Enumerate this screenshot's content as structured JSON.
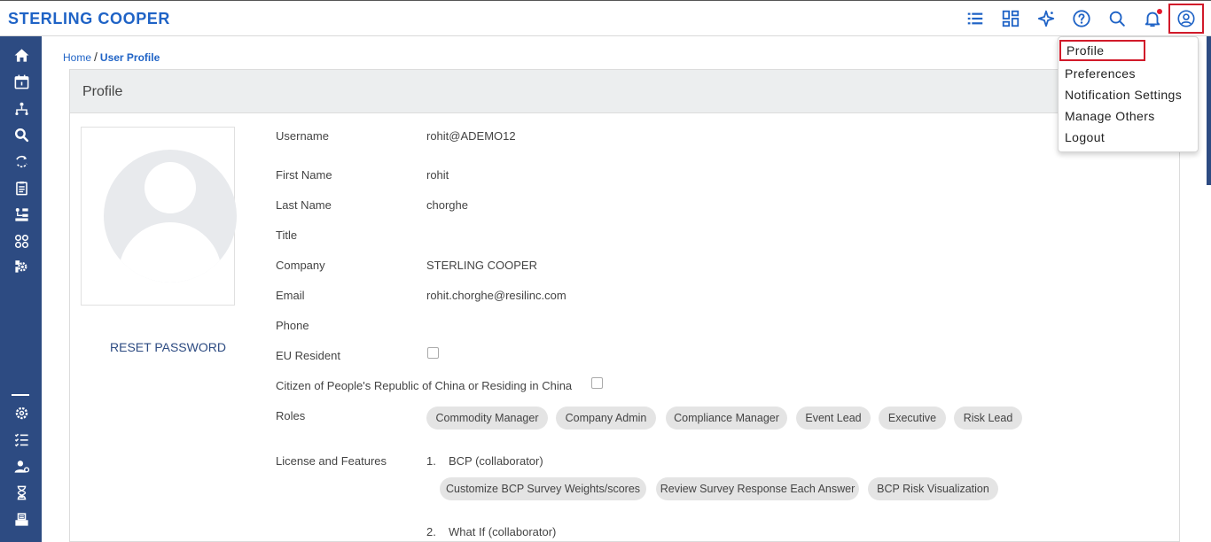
{
  "brand": "STERLING COOPER",
  "topbar": {
    "icons": [
      "list-icon",
      "dashboard-icon",
      "sparkle-icon",
      "help-icon",
      "search-icon",
      "bell-icon",
      "user-icon"
    ],
    "colors": {
      "icon": "#1f63c6",
      "notification_dot": "#e3192d",
      "highlight": "#d11a2a"
    }
  },
  "sidebar": {
    "background": "#2d4b82",
    "top_icons": [
      "home-icon",
      "calendar-icon",
      "network-icon",
      "search-doc-icon",
      "sync-icon",
      "clipboard-icon",
      "org-chart-icon",
      "apps-icon",
      "gear-stack-icon"
    ],
    "bottom_icons": [
      "settings-icon",
      "checklist-icon",
      "user-settings-icon",
      "hourglass-icon",
      "archive-icon"
    ]
  },
  "breadcrumb": {
    "home": "Home",
    "separator": "/",
    "current": "User Profile"
  },
  "card": {
    "title": "Profile"
  },
  "reset_password": "RESET PASSWORD",
  "fields": {
    "username_label": "Username",
    "username": "rohit@ADEMO12",
    "first_name_label": "First Name",
    "first_name": "rohit",
    "last_name_label": "Last Name",
    "last_name": "chorghe",
    "title_label": "Title",
    "company_label": "Company",
    "company": "STERLING COOPER",
    "email_label": "Email",
    "email": "rohit.chorghe@resilinc.com",
    "phone_label": "Phone",
    "eu_label": "EU Resident",
    "china_label": "Citizen of People's Republic of China or Residing in China",
    "roles_label": "Roles",
    "license_label": "License and Features"
  },
  "roles": [
    "Commodity Manager",
    "Company Admin",
    "Compliance Manager",
    "Event Lead",
    "Executive",
    "Risk Lead"
  ],
  "licenses": [
    {
      "num": "1.",
      "name": "BCP (collaborator)",
      "features": [
        "Customize BCP Survey Weights/scores",
        "Review Survey Response Each Answer",
        "BCP Risk Visualization"
      ]
    },
    {
      "num": "2.",
      "name": "What If (collaborator)",
      "features": []
    }
  ],
  "menu": {
    "items": [
      "Profile",
      "Preferences",
      "Notification Settings",
      "Manage Others",
      "Logout"
    ]
  }
}
